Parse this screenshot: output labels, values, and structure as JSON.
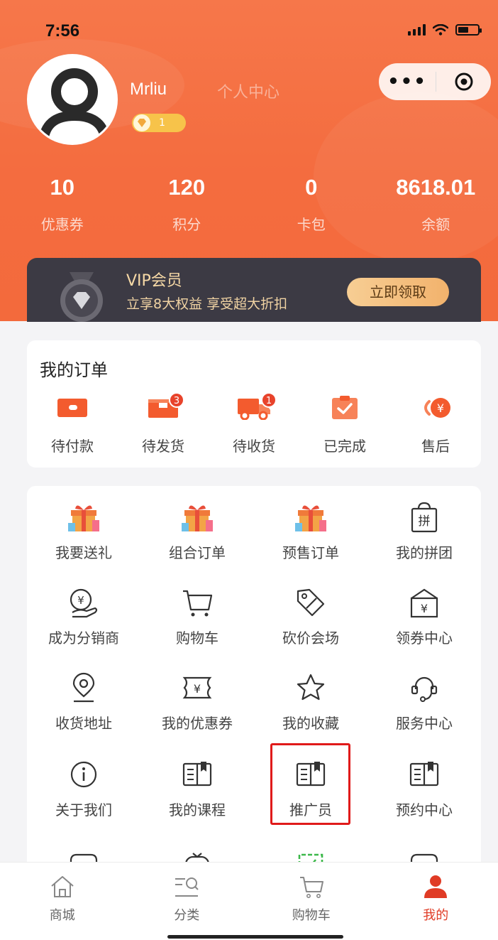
{
  "status_bar": {
    "time": "7:56"
  },
  "profile": {
    "username": "Mrliu",
    "page_title": "个人中心",
    "level": "1"
  },
  "capsule": {
    "more": "•••"
  },
  "stats": [
    {
      "value": "10",
      "label": "优惠券"
    },
    {
      "value": "120",
      "label": "积分"
    },
    {
      "value": "0",
      "label": "卡包"
    },
    {
      "value": "8618.01",
      "label": "余额"
    }
  ],
  "vip": {
    "title": "VIP会员",
    "subtitle": "立享8大权益 享受超大折扣",
    "button": "立即领取"
  },
  "orders": {
    "title": "我的订单",
    "items": [
      {
        "label": "待付款",
        "icon": "wallet-icon"
      },
      {
        "label": "待发货",
        "icon": "package-icon",
        "badge": "3"
      },
      {
        "label": "待收货",
        "icon": "truck-icon",
        "badge": "1"
      },
      {
        "label": "已完成",
        "icon": "clipboard-check-icon"
      },
      {
        "label": "售后",
        "icon": "yen-refund-icon"
      }
    ]
  },
  "services": [
    {
      "label": "我要送礼",
      "icon": "gift-icon"
    },
    {
      "label": "组合订单",
      "icon": "gift-icon"
    },
    {
      "label": "预售订单",
      "icon": "gift-icon"
    },
    {
      "label": "我的拼团",
      "icon": "group-buy-icon",
      "glyph": "拼"
    },
    {
      "label": "成为分销商",
      "icon": "distributor-icon"
    },
    {
      "label": "购物车",
      "icon": "cart-icon"
    },
    {
      "label": "砍价会场",
      "icon": "price-tag-icon"
    },
    {
      "label": "领券中心",
      "icon": "coupon-center-icon"
    },
    {
      "label": "收货地址",
      "icon": "location-icon"
    },
    {
      "label": "我的优惠券",
      "icon": "coupon-icon"
    },
    {
      "label": "我的收藏",
      "icon": "star-icon"
    },
    {
      "label": "服务中心",
      "icon": "headset-icon"
    },
    {
      "label": "关于我们",
      "icon": "info-icon"
    },
    {
      "label": "我的课程",
      "icon": "book-icon"
    },
    {
      "label": "推广员",
      "icon": "book-icon"
    },
    {
      "label": "预约中心",
      "icon": "book-icon"
    }
  ],
  "tabbar": [
    {
      "label": "商城",
      "icon": "home-icon"
    },
    {
      "label": "分类",
      "icon": "category-icon"
    },
    {
      "label": "购物车",
      "icon": "cart-icon"
    },
    {
      "label": "我的",
      "icon": "user-icon",
      "active": true
    }
  ],
  "colors": {
    "header": "#f46c3f",
    "accent": "#e03b25",
    "vip_bg": "#3c3a44",
    "vip_gold": "#f7d9a6",
    "highlight": "#e01a1a"
  }
}
